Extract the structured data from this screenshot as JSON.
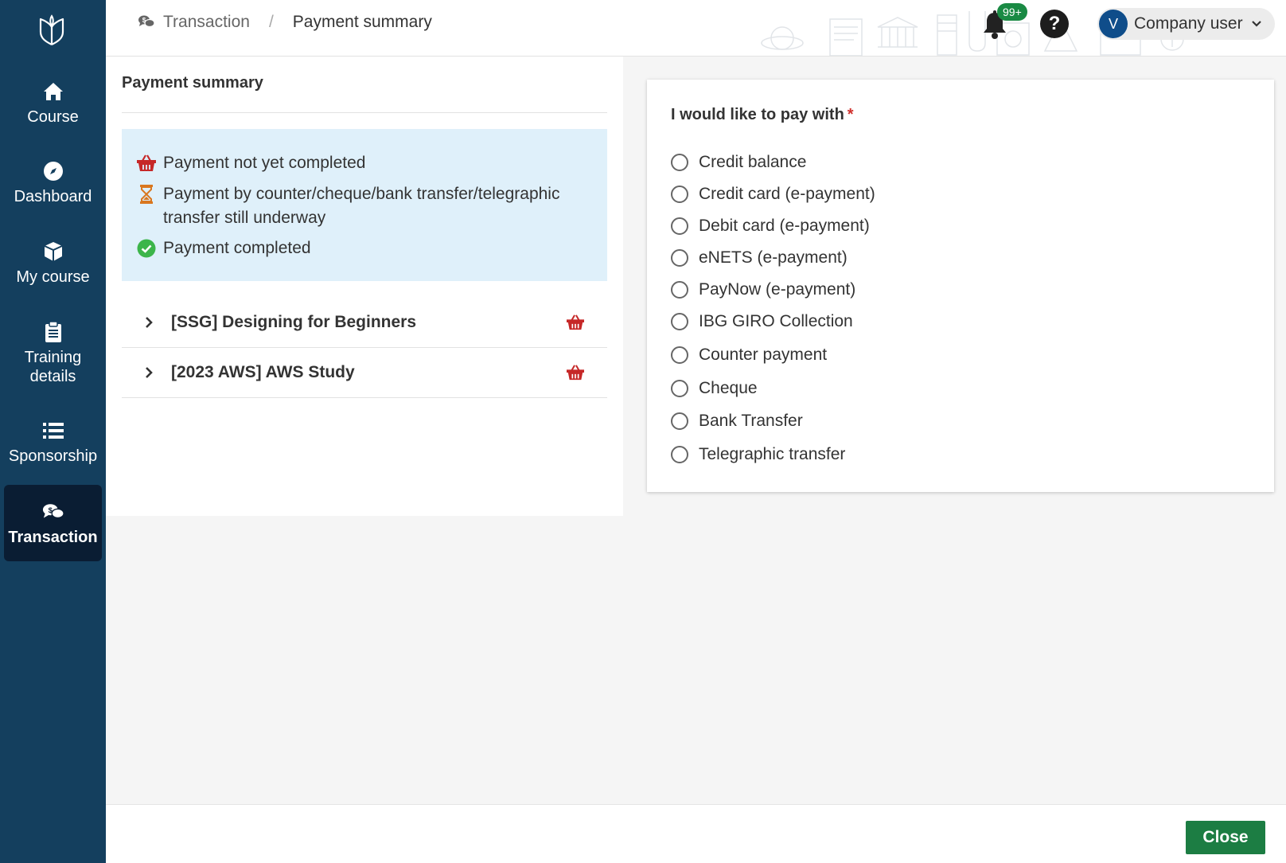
{
  "sidebar": {
    "logo": "book-leaf-logo",
    "items": [
      {
        "label": "Course",
        "icon": "home-icon"
      },
      {
        "label": "Dashboard",
        "icon": "compass-icon"
      },
      {
        "label": "My course",
        "icon": "cube-icon"
      },
      {
        "label": "Training details",
        "icon": "clipboard-icon"
      },
      {
        "label": "Sponsorship",
        "icon": "list-icon"
      },
      {
        "label": "Transaction",
        "icon": "chat-dollar-icon",
        "active": true
      }
    ]
  },
  "header": {
    "breadcrumb": {
      "root": "Transaction",
      "separator": "/",
      "current": "Payment summary"
    },
    "notifications_badge": "99+",
    "help_label": "?",
    "user": {
      "initial": "V",
      "name": "Company user"
    }
  },
  "summary": {
    "title": "Payment summary",
    "legend": [
      {
        "icon": "basket-icon",
        "color": "#c62828",
        "text": "Payment not yet completed"
      },
      {
        "icon": "hourglass-icon",
        "color": "#d9771f",
        "text": "Payment by counter/cheque/bank transfer/telegraphic transfer still underway"
      },
      {
        "icon": "check-circle-icon",
        "color": "#3cb54a",
        "text": "Payment completed"
      }
    ],
    "courses": [
      {
        "title": "[SSG] Designing for Beginners",
        "status_icon": "basket-icon"
      },
      {
        "title": "[2023 AWS] AWS Study",
        "status_icon": "basket-icon"
      }
    ]
  },
  "payment": {
    "title": "I would like to pay with",
    "required_mark": "*",
    "options": [
      "Credit balance",
      "Credit card (e-payment)",
      "Debit card (e-payment)",
      "eNETS (e-payment)",
      "PayNow (e-payment)",
      "IBG GIRO Collection",
      "Counter payment",
      "Cheque",
      "Bank Transfer",
      "Telegraphic transfer"
    ]
  },
  "footer": {
    "close_label": "Close"
  },
  "colors": {
    "sidebar": "#143f5e",
    "sidebar_active": "#0a1d33",
    "legend_bg": "#dff0fa",
    "primary_button": "#1c7d43",
    "badge": "#1a8a44",
    "status_red": "#c62828"
  }
}
